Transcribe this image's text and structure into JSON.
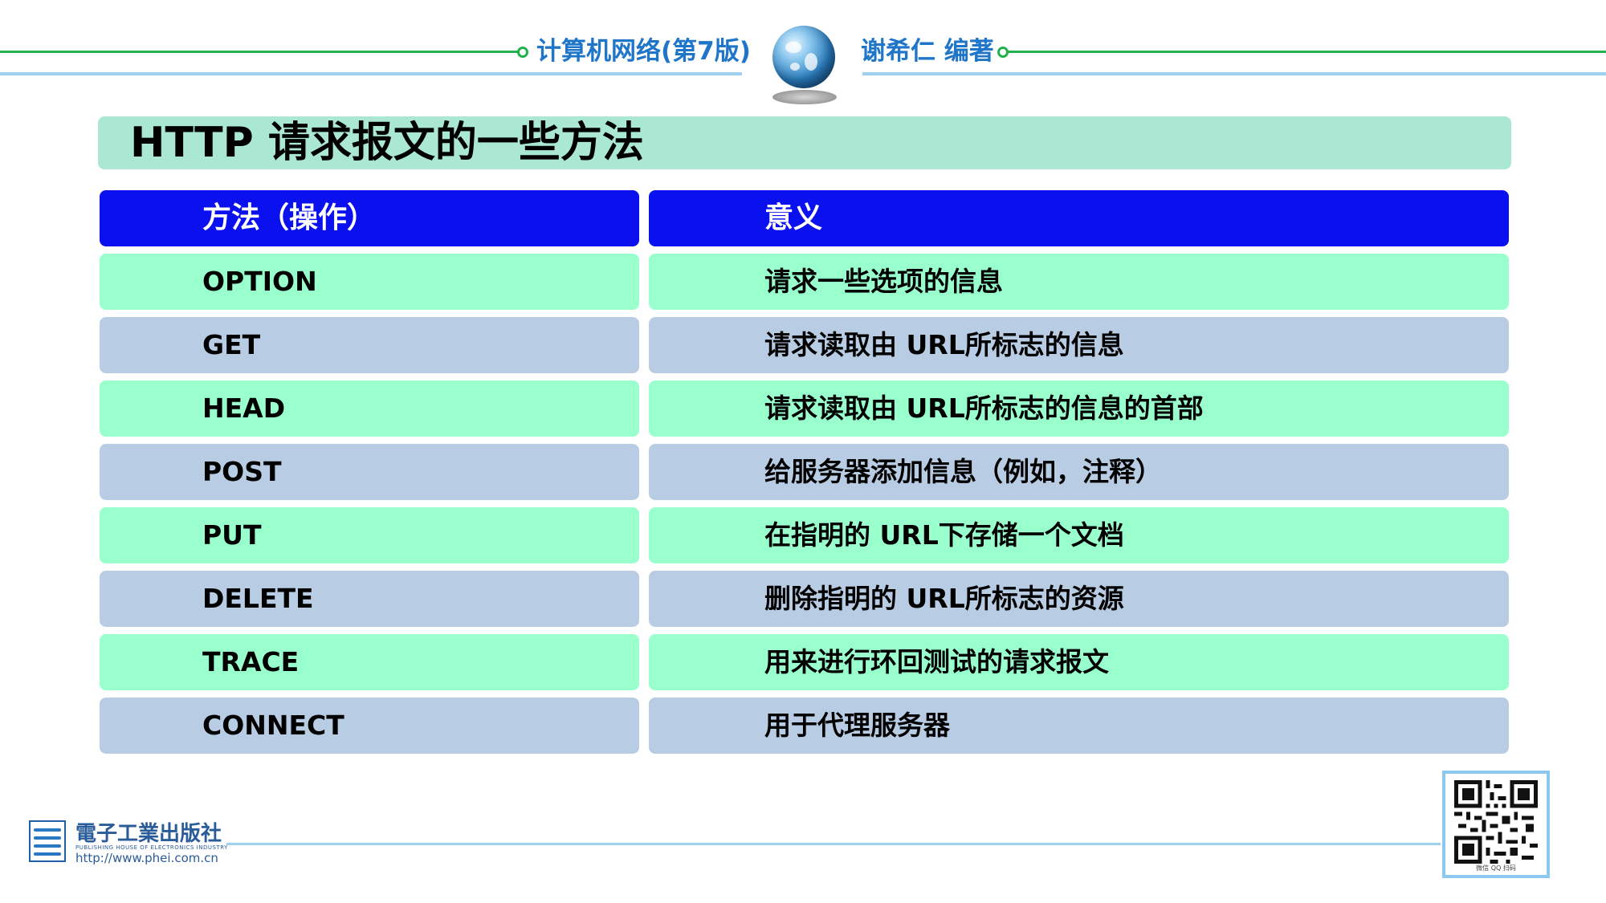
{
  "header": {
    "book_title": "计算机网络(第7版)",
    "author": "谢希仁 编著"
  },
  "title": "HTTP 请求报文的一些方法",
  "table": {
    "headers": [
      "方法（操作）",
      "意义"
    ],
    "rows": [
      {
        "method": "OPTION",
        "meaning": "请求一些选项的信息"
      },
      {
        "method": "GET",
        "meaning": "请求读取由 URL所标志的信息"
      },
      {
        "method": "HEAD",
        "meaning": "请求读取由 URL所标志的信息的首部"
      },
      {
        "method": "POST",
        "meaning": "给服务器添加信息（例如，注释）"
      },
      {
        "method": "PUT",
        "meaning": "在指明的 URL下存储一个文档"
      },
      {
        "method": "DELETE",
        "meaning": "删除指明的 URL所标志的资源"
      },
      {
        "method": "TRACE",
        "meaning": "用来进行环回测试的请求报文"
      },
      {
        "method": "CONNECT",
        "meaning": "用于代理服务器"
      }
    ]
  },
  "footer": {
    "publisher_cn": "電子工業出版社",
    "publisher_en": "PUBLISHING HOUSE OF ELECTRONICS INDUSTRY",
    "publisher_url": "http://www.phei.com.cn",
    "qr_caption": "微信 QQ 扫码"
  },
  "colors": {
    "header_row": "#0a10ee",
    "row_mint": "#99ffcc",
    "row_slate": "#b8cce4",
    "title_bar": "#abe8d4",
    "header_text": "#1f76c8",
    "header_line": "#22b14c"
  },
  "icons": {
    "globe": "globe-icon",
    "logo": "publisher-logo-icon",
    "qr": "qr-code-icon"
  }
}
